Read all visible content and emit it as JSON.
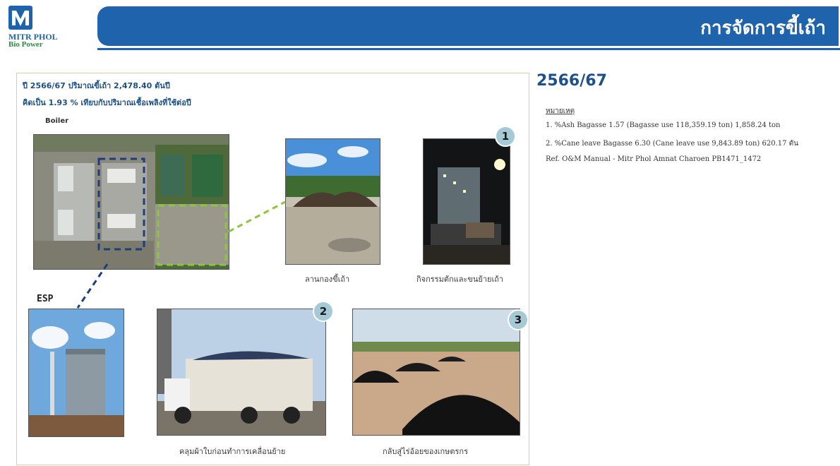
{
  "header": {
    "logo_name": "MITR PHOL",
    "logo_sub": "Bio Power",
    "title": "การจัดการขี้เถ้า"
  },
  "panel": {
    "info_line1": "ปี 2566/67 ปริมาณขี้เถ้า  2,478.40 ตันปี",
    "info_line2": "คิดเป็น 1.93 % เทียบกับปริมาณเชื้อเพลิงที่ใช้ต่อปี",
    "boiler_label": "Boiler",
    "esp_label": "ESP",
    "captions": {
      "ash_yard": "ลานกองขี้เถ้า",
      "loading_activity": "กิจกรรมตักและขนย้ายเถ้า",
      "cover_before_transport": "คลุมผ้าใบก่อนทำการเคลื่อนย้าย",
      "return_to_farmers": "กลับสู่ไร่อ้อยของเกษตรกร"
    },
    "badges": [
      "1",
      "2",
      "3"
    ]
  },
  "right": {
    "year": "2566/67",
    "notes_label": "หมายเหตุ",
    "notes": [
      "1. %Ash Bagasse 1.57 (Bagasse use   118,359.19 ton) 1,858.24  ton",
      "2. %Cane leave Bagasse 6.30 (Cane leave use   9,843.89 ton) 620.17 ตัน",
      "Ref. O&M Manual - Mitr Phol Amnat Charoen PB1471_1472"
    ]
  },
  "colors": {
    "brand_blue": "#1f63ad",
    "text_blue": "#1c4f84",
    "badge": "#a6c9d6",
    "highlight_green": "#8cc63f",
    "highlight_navy": "#1c3f7a"
  }
}
